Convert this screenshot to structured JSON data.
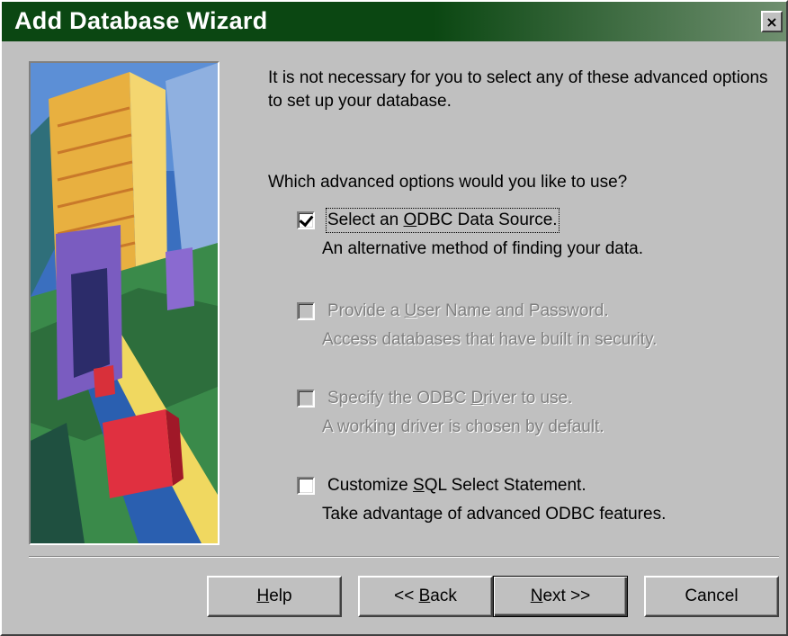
{
  "window": {
    "title": "Add Database Wizard",
    "close_glyph": "×"
  },
  "illustration": {
    "kind": "wizard-artwork"
  },
  "intro_text": "It is not necessary for you to select any of these advanced options to set up your database.",
  "question_text": "Which advanced options would you like to use?",
  "options": [
    {
      "label_pre": "Select an ",
      "label_u": "O",
      "label_post": "DBC Data Source.",
      "description": "An alternative method of finding your data.",
      "checked": true,
      "enabled": true,
      "focused": true
    },
    {
      "label_pre": "Provide a ",
      "label_u": "U",
      "label_post": "ser Name and Password.",
      "description": "Access databases that have built in security.",
      "checked": false,
      "enabled": false,
      "focused": false
    },
    {
      "label_pre": "Specify the ODBC ",
      "label_u": "D",
      "label_post": "river to use.",
      "description": "A working driver is chosen by default.",
      "checked": false,
      "enabled": false,
      "focused": false
    },
    {
      "label_pre": "Customize ",
      "label_u": "S",
      "label_post": "QL Select Statement.",
      "description": "Take advantage of advanced ODBC features.",
      "checked": false,
      "enabled": true,
      "focused": false
    }
  ],
  "buttons": {
    "help": {
      "pre": "",
      "u": "H",
      "post": "elp"
    },
    "back": {
      "pre": "<< ",
      "u": "B",
      "post": "ack"
    },
    "next": {
      "pre": "",
      "u": "N",
      "post": "ext >>"
    },
    "cancel": {
      "pre": "Cancel",
      "u": "",
      "post": ""
    }
  },
  "colors": {
    "titlebar_start": "#0b4712",
    "face": "#c0c0c0",
    "disabled_text": "#808080"
  }
}
